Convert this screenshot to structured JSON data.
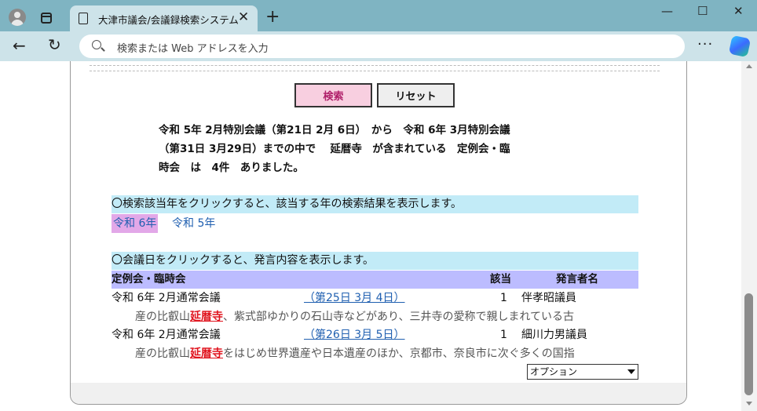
{
  "browser": {
    "tab_title": "大津市議会/会議録検索システム",
    "address_placeholder": "検索または Web アドレスを入力"
  },
  "search_form": {
    "search_button": "検索",
    "reset_button": "リセット"
  },
  "summary": {
    "line1": "令和 5年 2月特別会議（第21日 2月 6日）　から　令和 6年 3月特別会議",
    "line2": "（第31日 3月29日）までの中で　 延暦寺　が含まれている　定例会・臨",
    "line3": "時会　は　4件　ありました。"
  },
  "year_section": {
    "instruction": "〇検索該当年をクリックすると、該当する年の検索結果を表示します。",
    "years": [
      "令和 6年",
      "令和 5年"
    ]
  },
  "results_section": {
    "instruction": "〇会議日をクリックすると、発言内容を表示します。",
    "headers": {
      "meeting": "定例会・臨時会",
      "hits": "該当",
      "speaker": "発言者名"
    },
    "rows": [
      {
        "meeting": "令和 6年 2月通常会議",
        "date": "（第25日 3月 4日）",
        "hits": "1",
        "speaker": "伴孝昭議員",
        "excerpt_before": "産の比叡山",
        "excerpt_keyword": "延暦寺",
        "excerpt_after": "、紫式部ゆかりの石山寺などがあり、三井寺の愛称で親しまれている古"
      },
      {
        "meeting": "令和 6年 2月通常会議",
        "date": "（第26日 3月 5日）",
        "hits": "1",
        "speaker": "細川力男議員",
        "excerpt_before": "産の比叡山",
        "excerpt_keyword": "延暦寺",
        "excerpt_after": "をはじめ世界遺産や日本遺産のほか、京都市、奈良市に次ぐ多くの国指"
      }
    ],
    "options_select": "オプション"
  },
  "colors": {
    "browser_frame": "#7fb4c2",
    "toolbar": "#cde3e9",
    "info_bar": "#c2ebf7",
    "header_bar": "#bcbcff",
    "search_button_bg": "#f8cfe0",
    "link": "#1f5fb0",
    "keyword": "#e0141e",
    "selected_year": "#e2a8e8"
  }
}
